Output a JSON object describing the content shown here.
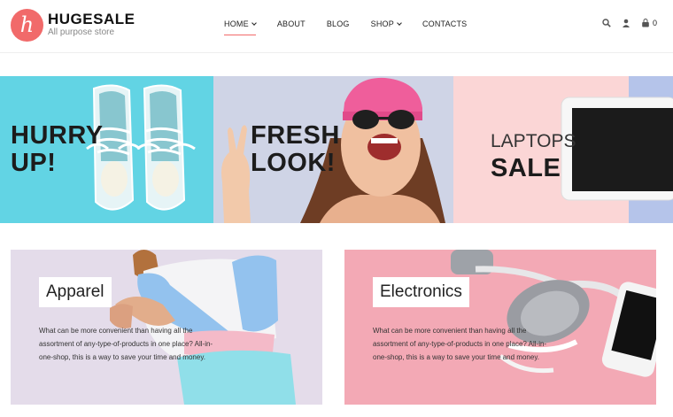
{
  "header": {
    "logo_letter": "h",
    "brand": "HUGESALE",
    "tagline": "All purpose store",
    "nav": [
      {
        "label": "HOME",
        "dropdown": true,
        "active": true
      },
      {
        "label": "ABOUT",
        "dropdown": false
      },
      {
        "label": "BLOG",
        "dropdown": false
      },
      {
        "label": "SHOP",
        "dropdown": true
      },
      {
        "label": "CONTACTS",
        "dropdown": false
      }
    ],
    "icons": [
      "search-icon",
      "user-icon",
      "cart-icon"
    ],
    "cart_count": "0"
  },
  "banners": [
    {
      "line1": "HURRY",
      "line2": "UP!",
      "bg": "#62d4e4"
    },
    {
      "line1": "FRESH",
      "line2": "LOOK!",
      "bg": "#cfd4e6"
    },
    {
      "line1": "LAPTOPS",
      "line2": "SALE",
      "bg": "#fbd6d6"
    }
  ],
  "cards": [
    {
      "title": "Apparel",
      "text": "What can be more convenient than having all the assortment of any-type-of-products in one place? All-in-one-shop, this is a way to save your time and money."
    },
    {
      "title": "Electronics",
      "text": "What can be more convenient than having all the assortment of any-type-of-products in one place? All-in-one-shop, this is a way to save your time and money."
    }
  ],
  "colors": {
    "accent": "#f16a6a",
    "banner_blue": "#62d4e4",
    "banner_pink": "#fbd6d6",
    "card_pink": "#f3a9b5",
    "card_lilac": "#e4dcea"
  }
}
